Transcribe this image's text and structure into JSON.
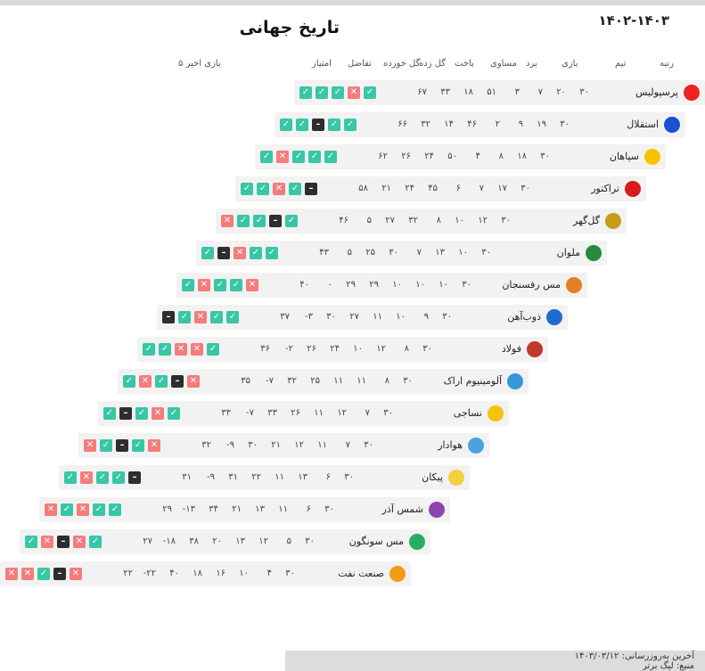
{
  "title": "تاریخ جهانی",
  "year": "۱۴۰۲-۱۴۰۳",
  "columns": [
    "رتبه",
    "تیم",
    "بازی",
    "برد",
    "مساوی",
    "باخت",
    "گل زده",
    "گل خورده",
    "تفاضل",
    "امتیاز",
    "۵ بازی اخیر"
  ],
  "rows": [
    {
      "name": "پرسپولیس",
      "sub": "",
      "played": "۳۰",
      "won": "۲۰",
      "drawn": "۷",
      "lost": "۳",
      "gf": "۵۱",
      "ga": "۱۸",
      "gd": "۳۳",
      "pts": "۶۷",
      "form": [
        "w",
        "w",
        "w",
        "l",
        "w"
      ],
      "color": "#e22"
    },
    {
      "name": "استقلال",
      "sub": "",
      "played": "۳۰",
      "won": "۱۹",
      "drawn": "۹",
      "lost": "۲",
      "gf": "۴۶",
      "ga": "۱۴",
      "gd": "۳۲",
      "pts": "۶۶",
      "form": [
        "w",
        "w",
        "d",
        "w",
        "w"
      ],
      "color": "#1a4fd6"
    },
    {
      "name": "سپاهان",
      "sub": "",
      "played": "۳۰",
      "won": "۱۸",
      "drawn": "۸",
      "lost": "۴",
      "gf": "۵۰",
      "ga": "۲۴",
      "gd": "۲۶",
      "pts": "۶۲",
      "form": [
        "w",
        "l",
        "w",
        "w",
        "w"
      ],
      "color": "#f5c400"
    },
    {
      "name": "تراکتور",
      "sub": "",
      "played": "۳۰",
      "won": "۱۷",
      "drawn": "۷",
      "lost": "۶",
      "gf": "۴۵",
      "ga": "۲۴",
      "gd": "۲۱",
      "pts": "۵۸",
      "form": [
        "w",
        "w",
        "l",
        "w",
        "d"
      ],
      "color": "#d71b1b"
    },
    {
      "name": "گل‌گهر",
      "sub": "",
      "played": "۳۰",
      "won": "۱۲",
      "drawn": "۱۰",
      "lost": "۸",
      "gf": "۳۲",
      "ga": "۲۷",
      "gd": "۵",
      "pts": "۴۶",
      "form": [
        "l",
        "w",
        "w",
        "d",
        "w"
      ],
      "color": "#c79a18"
    },
    {
      "name": "ملوان",
      "sub": "",
      "played": "۳۰",
      "won": "۱۰",
      "drawn": "۱۳",
      "lost": "۷",
      "gf": "۳۰",
      "ga": "۲۵",
      "gd": "۵",
      "pts": "۴۳",
      "form": [
        "w",
        "d",
        "l",
        "w",
        "w"
      ],
      "color": "#2a8a3c"
    },
    {
      "name": "مس رفسنجان",
      "sub": "",
      "played": "۳۰",
      "won": "۱۰",
      "drawn": "۱۰",
      "lost": "۱۰",
      "gf": "۲۹",
      "ga": "۲۹",
      "gd": "۰",
      "pts": "۴۰",
      "form": [
        "w",
        "l",
        "w",
        "w",
        "l"
      ],
      "color": "#e67e22"
    },
    {
      "name": "ذوب‌آهن",
      "sub": "",
      "played": "۳۰",
      "won": "۹",
      "drawn": "۱۰",
      "lost": "۱۱",
      "gf": "۲۷",
      "ga": "۳۰",
      "gd": "-۳",
      "pts": "۳۷",
      "form": [
        "d",
        "w",
        "l",
        "w",
        "w"
      ],
      "color": "#1f6bd1"
    },
    {
      "name": "فولاد",
      "sub": "",
      "played": "۳۰",
      "won": "۸",
      "drawn": "۱۲",
      "lost": "۱۰",
      "gf": "۲۴",
      "ga": "۲۶",
      "gd": "-۲",
      "pts": "۳۶",
      "form": [
        "w",
        "w",
        "l",
        "l",
        "w"
      ],
      "color": "#c0392b"
    },
    {
      "name": "آلومینیوم اراک",
      "sub": "",
      "played": "۳۰",
      "won": "۸",
      "drawn": "۱۱",
      "lost": "۱۱",
      "gf": "۲۵",
      "ga": "۳۲",
      "gd": "-۷",
      "pts": "۳۵",
      "form": [
        "w",
        "l",
        "w",
        "d",
        "l"
      ],
      "color": "#3498db"
    },
    {
      "name": "نساجی",
      "sub": "",
      "played": "۳۰",
      "won": "۷",
      "drawn": "۱۲",
      "lost": "۱۱",
      "gf": "۲۶",
      "ga": "۳۳",
      "gd": "-۷",
      "pts": "۳۳",
      "form": [
        "w",
        "d",
        "w",
        "l",
        "w"
      ],
      "color": "#f1c40f"
    },
    {
      "name": "هوادار",
      "sub": "",
      "played": "۳۰",
      "won": "۷",
      "drawn": "۱۱",
      "lost": "۱۲",
      "gf": "۲۱",
      "ga": "۳۰",
      "gd": "-۹",
      "pts": "۳۲",
      "form": [
        "l",
        "w",
        "d",
        "w",
        "l"
      ],
      "color": "#4aa3df"
    },
    {
      "name": "پیکان",
      "sub": "",
      "played": "۳۰",
      "won": "۶",
      "drawn": "۱۳",
      "lost": "۱۱",
      "gf": "۲۲",
      "ga": "۳۱",
      "gd": "-۹",
      "pts": "۳۱",
      "form": [
        "w",
        "l",
        "w",
        "w",
        "d"
      ],
      "color": "#f4d03f"
    },
    {
      "name": "شمس آذر",
      "sub": "",
      "played": "۳۰",
      "won": "۶",
      "drawn": "۱۱",
      "lost": "۱۳",
      "gf": "۲۱",
      "ga": "۳۴",
      "gd": "-۱۳",
      "pts": "۲۹",
      "form": [
        "l",
        "w",
        "l",
        "w",
        "w"
      ],
      "color": "#8e44ad"
    },
    {
      "name": "مس سونگون",
      "sub": "",
      "played": "۳۰",
      "won": "۵",
      "drawn": "۱۲",
      "lost": "۱۳",
      "gf": "۲۰",
      "ga": "۳۸",
      "gd": "-۱۸",
      "pts": "۲۷",
      "form": [
        "w",
        "l",
        "d",
        "l",
        "w"
      ],
      "color": "#27ae60"
    },
    {
      "name": "صنعت نفت",
      "sub": "",
      "played": "۳۰",
      "won": "۴",
      "drawn": "۱۰",
      "lost": "۱۶",
      "gf": "۱۸",
      "ga": "۴۰",
      "gd": "-۲۲",
      "pts": "۲۲",
      "form": [
        "l",
        "l",
        "w",
        "d",
        "l"
      ],
      "color": "#f39c12"
    }
  ],
  "footer_line1": "آخرین به‌روزرسانی: ۱۴۰۳/۰۳/۱۲",
  "footer_line2": "منبع: لیگ برتر"
}
